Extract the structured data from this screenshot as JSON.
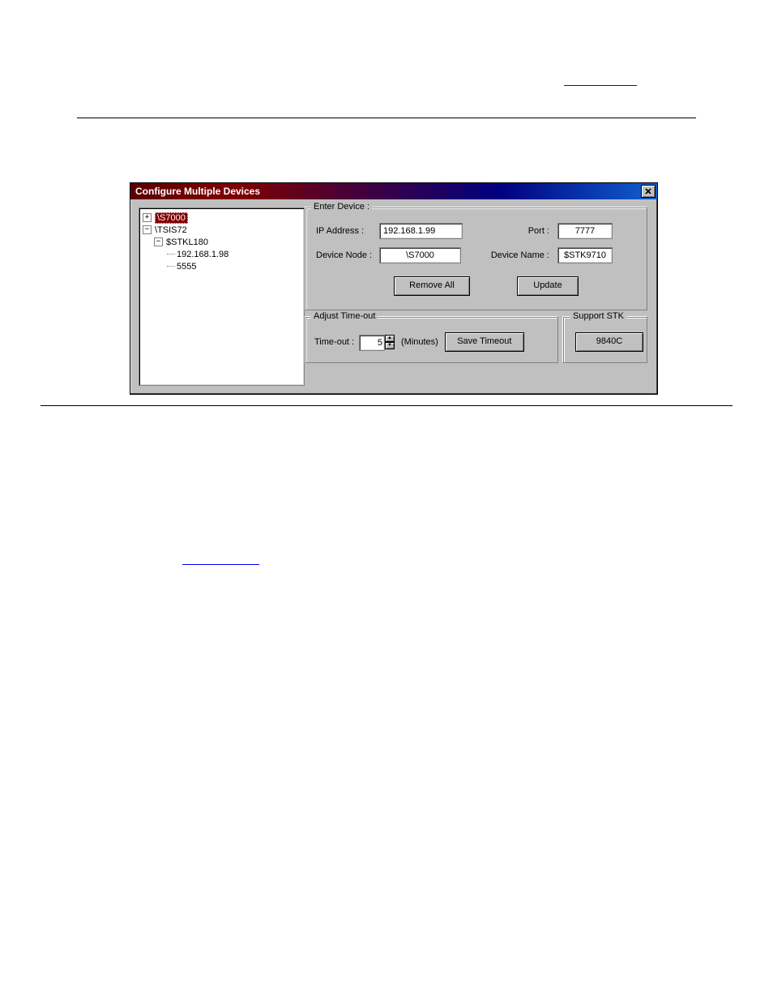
{
  "dialog": {
    "title": "Configure Multiple Devices"
  },
  "tree": {
    "n0": "\\S7000",
    "n1": "\\TSIS72",
    "n2": "$STKL180",
    "n3": "192.168.1.98",
    "n4": "5555"
  },
  "enter_device": {
    "legend": "Enter Device :",
    "ip_label": "IP Address :",
    "ip_value": "192.168.1.99",
    "port_label": "Port :",
    "port_value": "7777",
    "node_label": "Device Node :",
    "node_value": "\\S7000",
    "name_label": "Device Name :",
    "name_value": "$STK9710",
    "remove_all": "Remove All",
    "update": "Update"
  },
  "timeout": {
    "legend": "Adjust Time-out",
    "label": "Time-out :",
    "value": "5",
    "units": "(Minutes)",
    "save": "Save Timeout"
  },
  "stk": {
    "legend": "Support STK",
    "btn": "9840C"
  }
}
